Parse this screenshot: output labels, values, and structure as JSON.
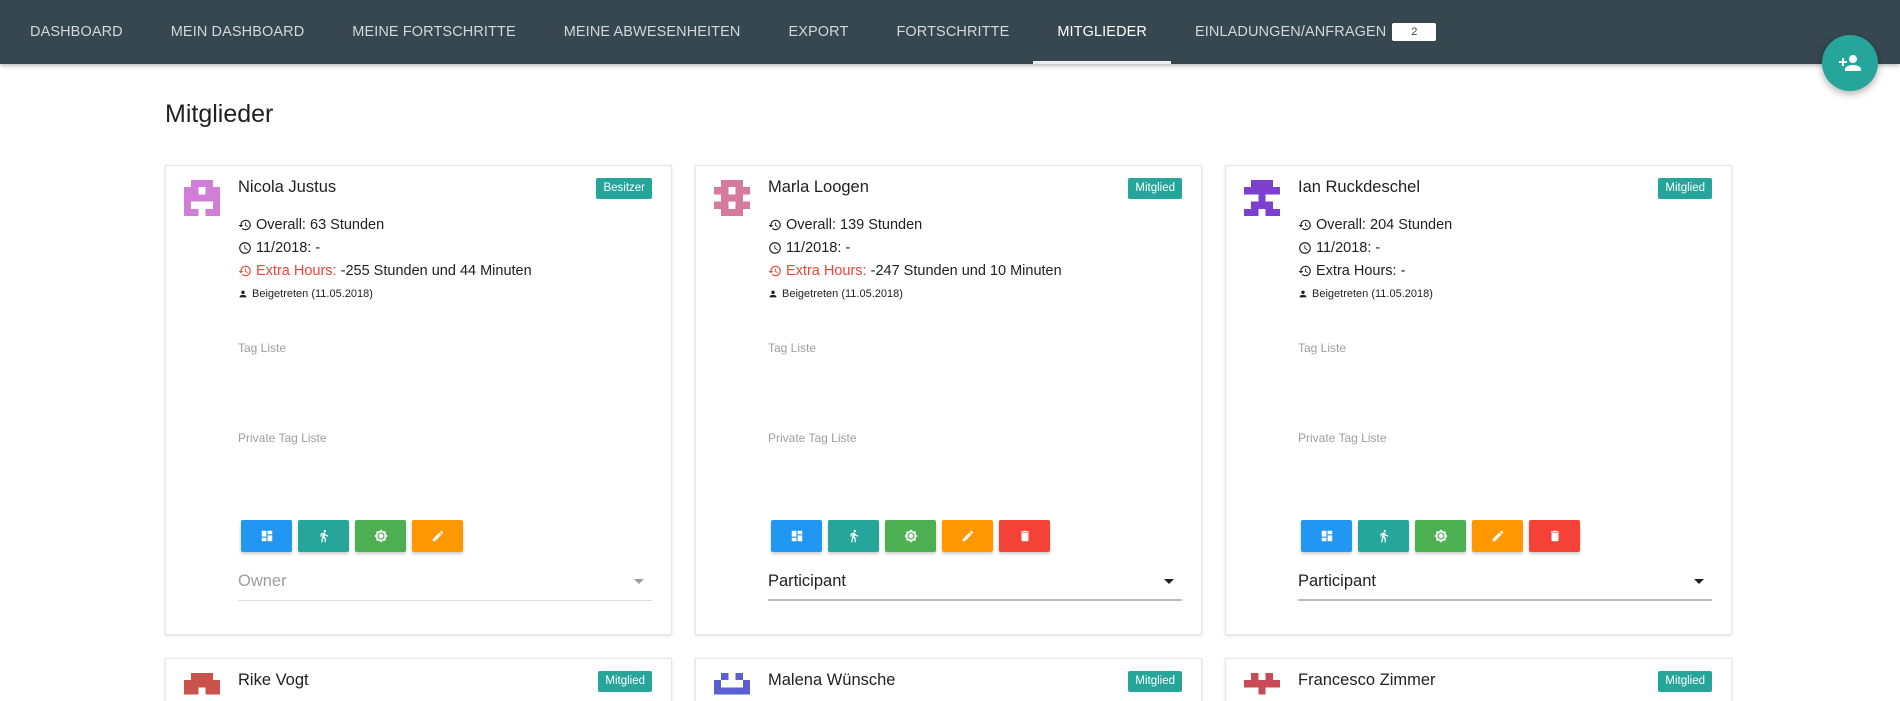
{
  "nav": {
    "tabs": [
      {
        "label": "DASHBOARD",
        "active": false
      },
      {
        "label": "MEIN DASHBOARD",
        "active": false
      },
      {
        "label": "MEINE FORTSCHRITTE",
        "active": false
      },
      {
        "label": "MEINE ABWESENHEITEN",
        "active": false
      },
      {
        "label": "EXPORT",
        "active": false
      },
      {
        "label": "FORTSCHRITTE",
        "active": false
      },
      {
        "label": "MITGLIEDER",
        "active": true
      },
      {
        "label": "EINLADUNGEN/ANFRAGEN",
        "active": false,
        "badge": "2"
      }
    ]
  },
  "fab": {
    "icon": "add-member-icon"
  },
  "page": {
    "title": "Mitglieder"
  },
  "labels": {
    "tag_list": "Tag Liste",
    "private_tag_list": "Private Tag Liste"
  },
  "members": [
    {
      "name": "Nicola Justus",
      "role": "Besitzer",
      "overall_label": "Overall:",
      "overall": "63 Stunden",
      "month_label": "11/2018:",
      "month": "-",
      "extra_label": "Extra Hours:",
      "extra": "-255 Stunden und 44 Minuten",
      "extra_negative": true,
      "joined": "Beigetreten (11.05.2018)",
      "select_value": "Owner",
      "select_disabled": true,
      "avatar_color": "#d17fd6"
    },
    {
      "name": "Marla Loogen",
      "role": "Mitglied",
      "overall_label": "Overall:",
      "overall": "139 Stunden",
      "month_label": "11/2018:",
      "month": "-",
      "extra_label": "Extra Hours:",
      "extra": "-247 Stunden und 10 Minuten",
      "extra_negative": true,
      "joined": "Beigetreten (11.05.2018)",
      "select_value": "Participant",
      "select_disabled": false,
      "avatar_color": "#d67a9d"
    },
    {
      "name": "Ian Ruckdeschel",
      "role": "Mitglied",
      "overall_label": "Overall:",
      "overall": "204 Stunden",
      "month_label": "11/2018:",
      "month": "-",
      "extra_label": "Extra Hours:",
      "extra": "-",
      "extra_negative": false,
      "joined": "Beigetreten (11.05.2018)",
      "select_value": "Participant",
      "select_disabled": false,
      "avatar_color": "#7d3fcf"
    },
    {
      "name": "Rike Vogt",
      "role": "Mitglied",
      "avatar_color": "#c9524a"
    },
    {
      "name": "Malena Wünsche",
      "role": "Mitglied",
      "avatar_color": "#5a5fd1"
    },
    {
      "name": "Francesco Zimmer",
      "role": "Mitglied",
      "avatar_color": "#c94a56"
    }
  ],
  "colors": {
    "nav_bg": "#37474f",
    "accent_teal": "#26a69a",
    "btn_blue": "#2196f3",
    "btn_green": "#4caf50",
    "btn_orange": "#ff9800",
    "btn_red": "#f44336"
  },
  "action_icons": [
    "dashboard-icon",
    "walk-icon",
    "brightness-icon",
    "edit-icon",
    "delete-icon"
  ]
}
